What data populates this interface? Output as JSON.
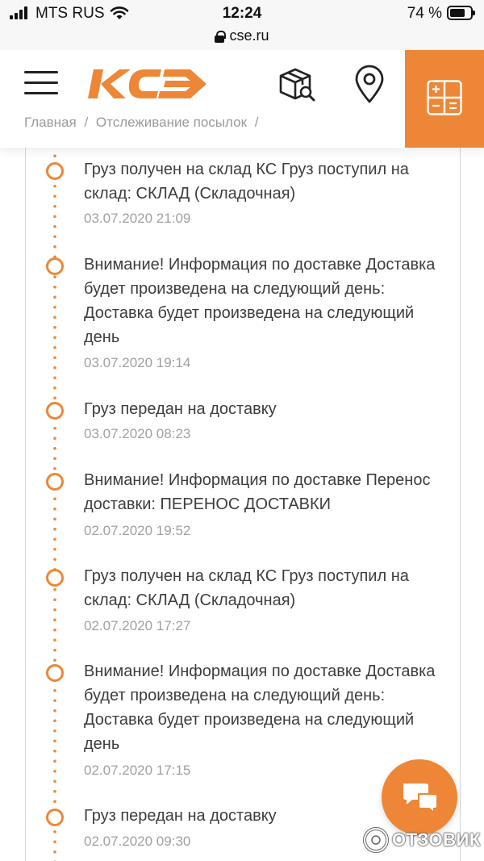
{
  "status_bar": {
    "carrier": "MTS RUS",
    "time": "12:24",
    "battery_percent": "74 %",
    "battery_level": 0.74
  },
  "url_bar": {
    "url": "cse.ru"
  },
  "header": {
    "logo_alt": "КС",
    "accent_color": "#ed8737",
    "breadcrumb": [
      "Главная",
      "/",
      "Отслеживание посылок",
      "/"
    ]
  },
  "timeline": {
    "events": [
      {
        "text": "Груз получен на склад КС Груз поступил на склад: СКЛАД (Складочная)",
        "date": "03.07.2020 21:09"
      },
      {
        "text": "Внимание! Информация по доставке Доставка будет произведена на следующий день: Доставка будет произведена на следующий день",
        "date": "03.07.2020 19:14"
      },
      {
        "text": "Груз передан на доставку",
        "date": "03.07.2020 08:23"
      },
      {
        "text": "Внимание! Информация по доставке Перенос доставки: ПЕРЕНОС ДОСТАВКИ",
        "date": "02.07.2020 19:52"
      },
      {
        "text": "Груз получен на склад КС Груз поступил на склад: СКЛАД (Складочная)",
        "date": "02.07.2020 17:27"
      },
      {
        "text": "Внимание! Информация по доставке Доставка будет произведена на следующий день: Доставка будет произведена на следующий день",
        "date": "02.07.2020 17:15"
      },
      {
        "text": "Груз передан на доставку",
        "date": "02.07.2020 09:30"
      }
    ]
  },
  "watermark": {
    "text": "ОТЗОВИК"
  }
}
